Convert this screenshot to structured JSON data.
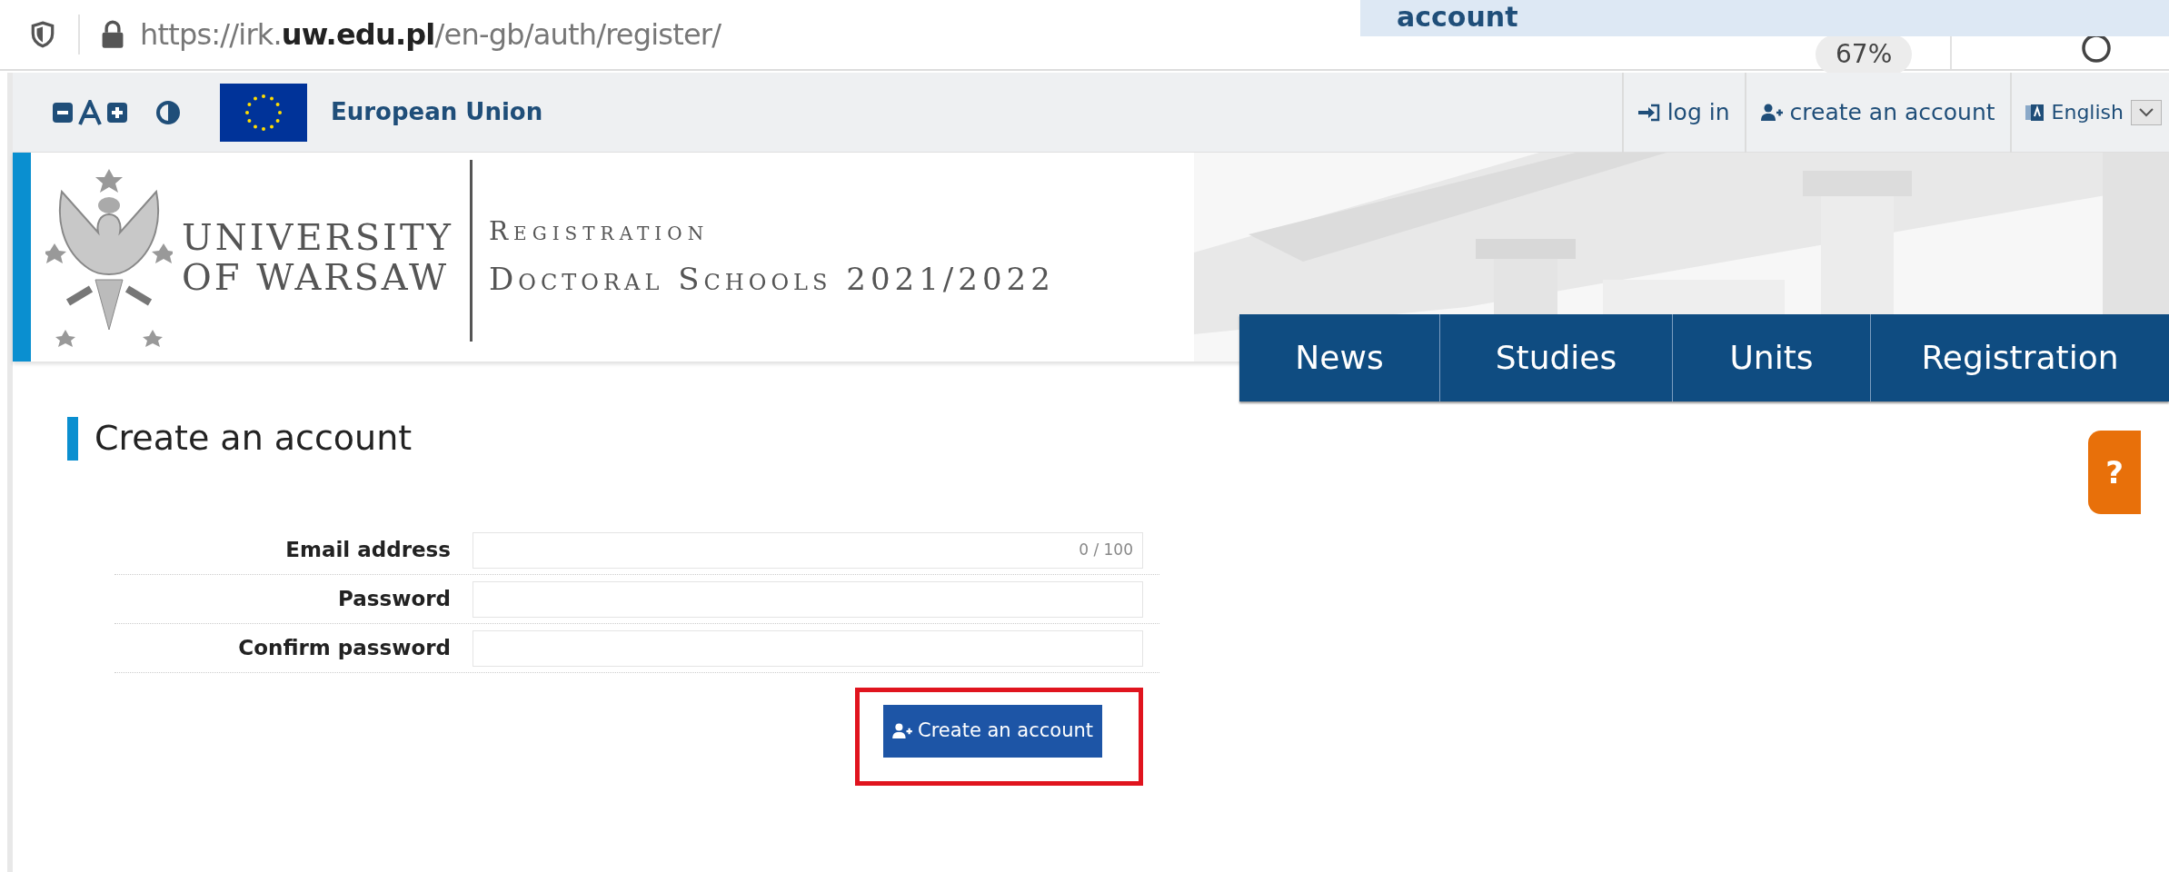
{
  "browser": {
    "url": "https://irk.**uw.edu.pl**/en-gb/auth/register/",
    "zoom": "67%"
  },
  "banner": {
    "text": "account"
  },
  "utility_bar": {
    "eu_label": "European Union",
    "links": [
      {
        "kind": "login",
        "label": "log in"
      },
      {
        "kind": "register",
        "label": "create an account"
      }
    ],
    "language": "English"
  },
  "header": {
    "university": [
      "UNIVERSITY",
      "OF WARSAW"
    ],
    "title": "Registration",
    "subtitle": "Doctoral Schools 2021/2022"
  },
  "nav": [
    {
      "label": "News"
    },
    {
      "label": "Studies"
    },
    {
      "label": "Units"
    },
    {
      "label": "Registration"
    }
  ],
  "help": {
    "label": "?"
  },
  "page": {
    "heading": "Create an account",
    "fields": [
      {
        "label": "Email address",
        "counter": "0 / 100"
      },
      {
        "label": "Password"
      },
      {
        "label": "Confirm password"
      }
    ],
    "submit": "Create an account",
    "submit_highlighted": true
  }
}
